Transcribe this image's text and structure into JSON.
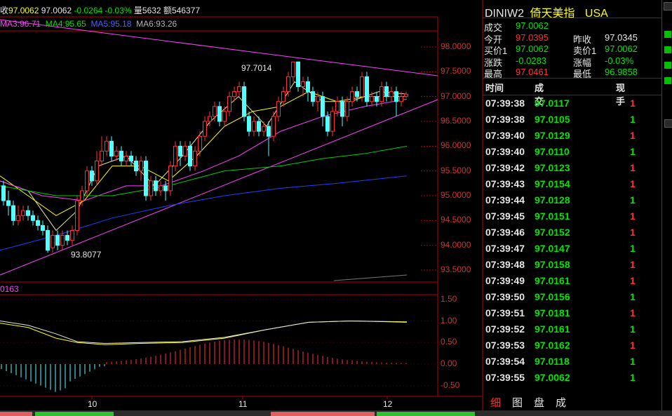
{
  "header": {
    "info_prefix": "收",
    "close_value": "97.0062",
    "last": "97.0062",
    "change": "-0.0264",
    "change_pct": "-0.03%",
    "volume": "量5632",
    "amount": "额546377"
  },
  "ma_bar": {
    "ma3": "MA3:96.71",
    "ma4": "MA4:95.65",
    "ma5": "MA5:95.18",
    "ma6": "MA6:93.26"
  },
  "chart_data": {
    "type": "candlestick",
    "price_axis": [
      "98.0000",
      "97.5000",
      "97.0000",
      "96.5000",
      "96.0000",
      "95.5000",
      "95.0000",
      "94.5000",
      "94.0000",
      "93.5000"
    ],
    "price_range": [
      93.3,
      98.4
    ],
    "annotations": {
      "high_label": "97.7014",
      "low_label": "93.8077"
    },
    "indicator_axis": [
      "1.50",
      "1.00",
      "0.50",
      "0.00",
      "-0.50"
    ],
    "indicator_label": "0163",
    "time_axis": [
      "10",
      "11",
      "12"
    ]
  },
  "quote": {
    "code": "DINIW2",
    "name": "倚天美指",
    "market": "USA",
    "rows": [
      {
        "label1": "成交",
        "value1": "97.0062",
        "color1": "#00e600",
        "label2": "",
        "value2": "",
        "color2": ""
      },
      {
        "label1": "今开",
        "value1": "97.0395",
        "color1": "#ff3232",
        "label2": "昨收",
        "value2": "97.0345",
        "color2": "#e6e6e6"
      },
      {
        "label1": "买价1",
        "value1": "97.0062",
        "color1": "#00e600",
        "label2": "卖价1",
        "value2": "97.0062",
        "color2": "#00e600"
      },
      {
        "label1": "涨跌",
        "value1": "-0.0283",
        "color1": "#00e600",
        "label2": "涨幅",
        "value2": "-0.03%",
        "color2": "#00e600"
      },
      {
        "label1": "最高",
        "value1": "97.0461",
        "color1": "#ff3232",
        "label2": "最低",
        "value2": "96.9858",
        "color2": "#00e600"
      }
    ]
  },
  "ticks_header": {
    "time": "时间",
    "price": "成交",
    "hand": "现手"
  },
  "ticks": [
    {
      "time": "07:39:38",
      "price": "97.0117",
      "hand": "1",
      "hand_color": "#ff3232"
    },
    {
      "time": "07:39:38",
      "price": "97.0105",
      "hand": "1",
      "hand_color": "#00e600"
    },
    {
      "time": "07:39:40",
      "price": "97.0129",
      "hand": "1",
      "hand_color": "#ff3232"
    },
    {
      "time": "07:39:40",
      "price": "97.0110",
      "hand": "1",
      "hand_color": "#00e600"
    },
    {
      "time": "07:39:42",
      "price": "97.0123",
      "hand": "1",
      "hand_color": "#ff3232"
    },
    {
      "time": "07:39:43",
      "price": "97.0154",
      "hand": "1",
      "hand_color": "#ff3232"
    },
    {
      "time": "07:39:44",
      "price": "97.0128",
      "hand": "1",
      "hand_color": "#00e600"
    },
    {
      "time": "07:39:45",
      "price": "97.0151",
      "hand": "1",
      "hand_color": "#ff3232"
    },
    {
      "time": "07:39:46",
      "price": "97.0152",
      "hand": "1",
      "hand_color": "#ff3232"
    },
    {
      "time": "07:39:47",
      "price": "97.0147",
      "hand": "1",
      "hand_color": "#00e600"
    },
    {
      "time": "07:39:48",
      "price": "97.0158",
      "hand": "1",
      "hand_color": "#ff3232"
    },
    {
      "time": "07:39:49",
      "price": "97.0161",
      "hand": "1",
      "hand_color": "#ff3232"
    },
    {
      "time": "07:39:50",
      "price": "97.0156",
      "hand": "1",
      "hand_color": "#00e600"
    },
    {
      "time": "07:39:51",
      "price": "97.0181",
      "hand": "1",
      "hand_color": "#ff3232"
    },
    {
      "time": "07:39:52",
      "price": "97.0161",
      "hand": "1",
      "hand_color": "#00e600"
    },
    {
      "time": "07:39:53",
      "price": "97.0162",
      "hand": "1",
      "hand_color": "#ff3232"
    },
    {
      "time": "07:39:54",
      "price": "97.0118",
      "hand": "1",
      "hand_color": "#00e600"
    },
    {
      "time": "07:39:55",
      "price": "97.0062",
      "hand": "1",
      "hand_color": "#00e600"
    }
  ],
  "tabs": [
    "细",
    "图",
    "盘",
    "成"
  ]
}
